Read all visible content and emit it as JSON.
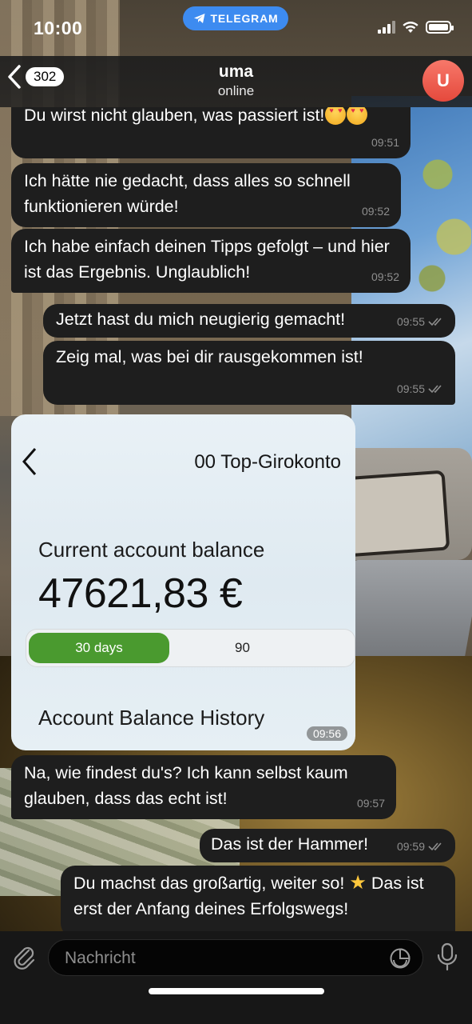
{
  "status_bar": {
    "time": "10:00",
    "app_pill": "TELEGRAM"
  },
  "header": {
    "back_count": "302",
    "chat_name": "uma",
    "chat_status": "online",
    "avatar_letter": "U"
  },
  "messages": [
    {
      "text": "Du wirst nicht glauben, was passiert ist!",
      "emoji": "heart-eyes-emoji",
      "time": "09:51",
      "direction": "incoming"
    },
    {
      "text": "Ich hätte nie gedacht, dass alles so schnell funktionieren würde!",
      "time": "09:52",
      "direction": "incoming"
    },
    {
      "text": "Ich habe einfach deinen Tipps gefolgt – und hier ist das Ergebnis. Unglaublich!",
      "time": "09:52",
      "direction": "incoming"
    },
    {
      "text": "Jetzt hast du mich neugierig gemacht!",
      "time": "09:55",
      "direction": "outgoing",
      "read": true
    },
    {
      "text": "Zeig mal, was bei dir rausgekommen ist!",
      "time": "09:55",
      "direction": "outgoing",
      "read": true
    },
    {
      "text": "Na, wie findest du's? Ich kann selbst kaum glauben, dass das echt ist!",
      "time": "09:57",
      "direction": "incoming"
    },
    {
      "text": "Das ist der Hammer!",
      "time": "09:59",
      "direction": "outgoing",
      "read": true
    },
    {
      "text_before": "Du machst das großartig, weiter so!",
      "text_after": "Das ist erst der Anfang deines Erfolgswegs!",
      "emoji": "star-emoji",
      "direction": "outgoing"
    }
  ],
  "image_message": {
    "account_title": "00 Top-Girokonto",
    "balance_label": "Current account balance",
    "balance_amount": "47621,83 €",
    "segment_active": "30 days",
    "segment_inactive": "90",
    "history_label": "Account Balance History",
    "time": "09:56"
  },
  "composer": {
    "placeholder": "Nachricht"
  },
  "colors": {
    "bubble": "#1e1e1e",
    "telegram_blue": "#3d8bf0",
    "avatar": "#ea5447",
    "toggle_green": "#4a9a2f"
  }
}
